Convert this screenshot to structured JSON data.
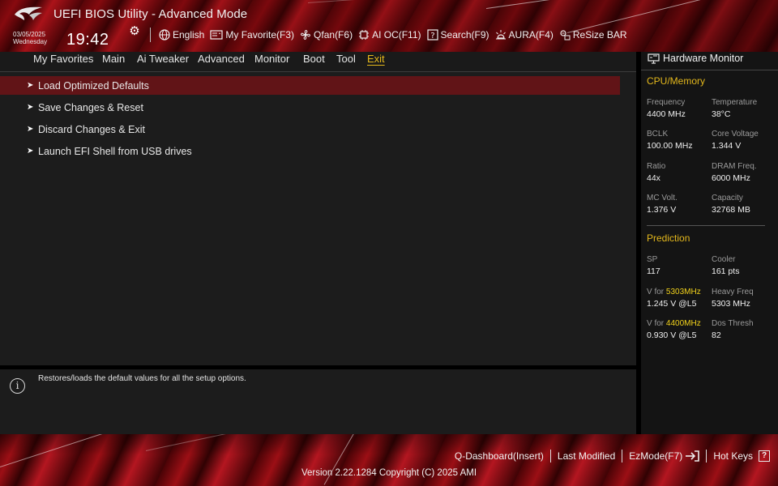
{
  "header": {
    "title": "UEFI BIOS Utility - Advanced Mode",
    "date": "03/05/2025",
    "weekday": "Wednesday",
    "time": "19:42",
    "toolbar": [
      {
        "id": "language",
        "label": "English",
        "icon": "globe-icon"
      },
      {
        "id": "my-favorite",
        "label": "My Favorite(F3)",
        "icon": "favorite-icon"
      },
      {
        "id": "qfan",
        "label": "Qfan(F6)",
        "icon": "fan-icon"
      },
      {
        "id": "ai-oc",
        "label": "AI OC(F11)",
        "icon": "ai-chip-icon"
      },
      {
        "id": "search",
        "label": "Search(F9)",
        "icon": "search-box-icon"
      },
      {
        "id": "aura",
        "label": "AURA(F4)",
        "icon": "aura-light-icon"
      },
      {
        "id": "resize-bar",
        "label": "ReSize BAR",
        "icon": "resize-bar-icon"
      }
    ]
  },
  "nav": {
    "tabs": [
      "My Favorites",
      "Main",
      "Ai Tweaker",
      "Advanced",
      "Monitor",
      "Boot",
      "Tool",
      "Exit"
    ],
    "active": "Exit"
  },
  "main": {
    "items": [
      {
        "label": "Load Optimized Defaults",
        "selected": true
      },
      {
        "label": "Save Changes & Reset",
        "selected": false
      },
      {
        "label": "Discard Changes & Exit",
        "selected": false
      },
      {
        "label": "Launch EFI Shell from USB drives",
        "selected": false
      }
    ]
  },
  "help": {
    "text": "Restores/loads the default values for all the setup options."
  },
  "hardware_monitor": {
    "title": "Hardware Monitor",
    "cpu_memory": {
      "title": "CPU/Memory",
      "frequency": {
        "label": "Frequency",
        "value": "4400 MHz"
      },
      "temperature": {
        "label": "Temperature",
        "value": "38°C"
      },
      "bclk": {
        "label": "BCLK",
        "value": "100.00 MHz"
      },
      "core_voltage": {
        "label": "Core Voltage",
        "value": "1.344 V"
      },
      "ratio": {
        "label": "Ratio",
        "value": "44x"
      },
      "dram_freq": {
        "label": "DRAM Freq.",
        "value": "6000 MHz"
      },
      "mc_volt": {
        "label": "MC Volt.",
        "value": "1.376 V"
      },
      "capacity": {
        "label": "Capacity",
        "value": "32768 MB"
      }
    },
    "prediction": {
      "title": "Prediction",
      "sp": {
        "label": "SP",
        "value": "117"
      },
      "cooler": {
        "label": "Cooler",
        "value": "161 pts"
      },
      "v_for_1": {
        "label_prefix": "V for ",
        "label_freq": "5303MHz",
        "value": "1.245 V @L5"
      },
      "heavy_freq": {
        "label": "Heavy Freq",
        "value": "5303 MHz"
      },
      "v_for_2": {
        "label_prefix": "V for ",
        "label_freq": "4400MHz",
        "value": "0.930 V @L5"
      },
      "dos_thresh": {
        "label": "Dos Thresh",
        "value": "82"
      }
    }
  },
  "footer": {
    "links": [
      {
        "id": "q-dashboard",
        "label": "Q-Dashboard(Insert)"
      },
      {
        "id": "last-modified",
        "label": "Last Modified"
      },
      {
        "id": "ezmode",
        "label": "EzMode(F7)"
      },
      {
        "id": "hot-keys",
        "label": "Hot Keys"
      }
    ],
    "copyright": "Version 2.22.1284 Copyright (C) 2025 AMI"
  },
  "colors": {
    "accent": "#e4b81c",
    "selected_row": "#611417",
    "panel": "#1c1c1c",
    "highlight_freq": "#f2d21b"
  }
}
